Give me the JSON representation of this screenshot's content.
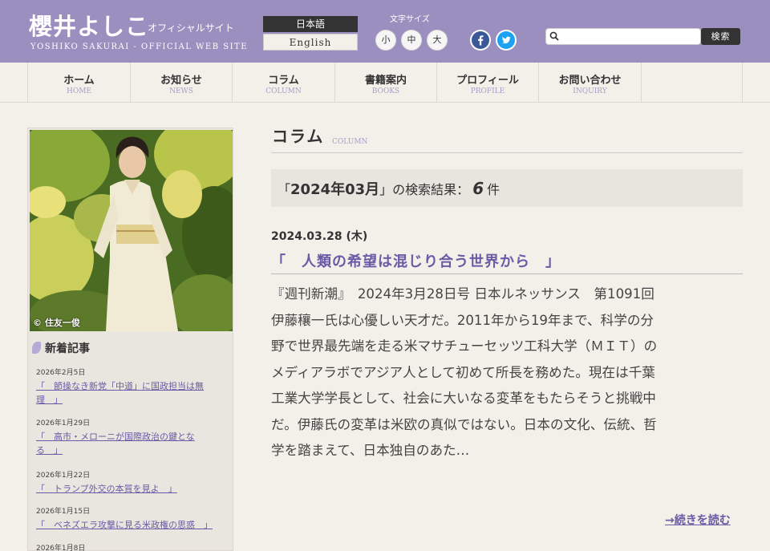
{
  "header": {
    "site_title": "櫻井よしこ",
    "site_title_sub": "オフィシャルサイト",
    "site_title_en": "YOSHIKO SAKURAI - OFFICIAL WEB SITE",
    "lang_ja": "日本語",
    "lang_en": "English",
    "font_size_label": "文字サイズ",
    "font_small": "小",
    "font_medium": "中",
    "font_large": "大",
    "search_placeholder": "",
    "search_button": "検索",
    "colors": {
      "header_bg": "#9b8fbf",
      "accent": "#6b5aa6"
    }
  },
  "nav": [
    {
      "ja": "ホーム",
      "en": "HOME"
    },
    {
      "ja": "お知らせ",
      "en": "NEWS"
    },
    {
      "ja": "コラム",
      "en": "COLUMN"
    },
    {
      "ja": "書籍案内",
      "en": "BOOKS"
    },
    {
      "ja": "プロフィール",
      "en": "PROFILE"
    },
    {
      "ja": "お問い合わせ",
      "en": "INQUIRY"
    }
  ],
  "sidebar": {
    "photo_credit": "© 住友一俊",
    "news_heading": "新着記事",
    "news": [
      {
        "date": "2026年2月5日",
        "line1": "「　節操なき新党「中道」に国政担当は無",
        "line2": "理　」"
      },
      {
        "date": "2026年1月29日",
        "line1": "「　高市・メローニが国際政治の鍵とな",
        "line2": "る　」"
      },
      {
        "date": "2026年1月22日",
        "line1": "「　トランプ外交の本質を見よ　」",
        "line2": ""
      },
      {
        "date": "2026年1月15日",
        "line1": "「　ベネズエラ攻撃に見る米政権の思惑　」",
        "line2": ""
      },
      {
        "date": "2026年1月8日",
        "line1": "",
        "line2": ""
      }
    ]
  },
  "main": {
    "title": "コラム",
    "title_en": "COLUMN",
    "result_prefix": "「",
    "result_query": "2024年03月",
    "result_suffix": "」の検索結果：",
    "result_count": "6",
    "result_unit": "件",
    "article": {
      "date": "2024.03.28 (木)",
      "title": "「　人類の希望は混じり合う世界から　」",
      "body_lines": [
        "『週刊新潮』　2024年3月28日号 日本ルネッサンス　第1091回",
        "伊藤穰一氏は心優しい天才だ。2011年から19年まで、科学の分",
        "野で世界最先端を走る米マサチューセッツ工科大学（ＭＩＴ）の",
        "メディアラボでアジア人として初めて所長を務めた。現在は千葉",
        "工業大学学長として、社会に大いなる変革をもたらそうと挑戦中",
        "だ。伊藤氏の変革は米欧の真似ではない。日本の文化、伝統、哲",
        "学を踏まえて、日本独自のあた…"
      ],
      "read_more": "→続きを読む"
    }
  }
}
